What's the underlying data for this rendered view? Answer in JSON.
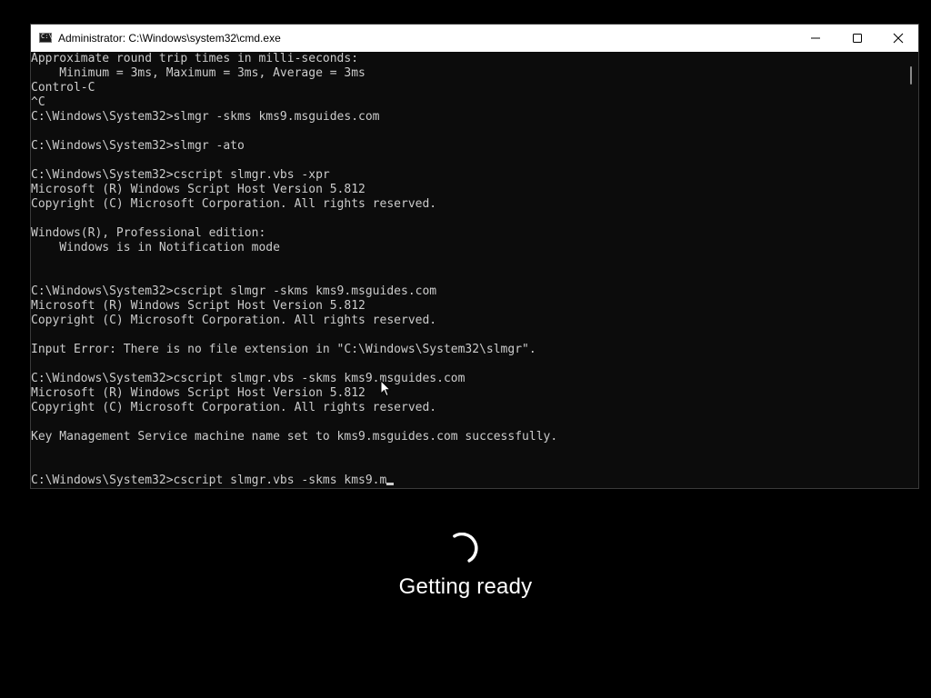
{
  "window": {
    "title": "Administrator: C:\\Windows\\system32\\cmd.exe",
    "icon": "cmd-app-icon",
    "controls": {
      "minimize_icon": "minimize-icon",
      "maximize_icon": "maximize-icon",
      "close_icon": "close-icon"
    }
  },
  "terminal": {
    "background": "#0c0c0c",
    "foreground": "#cccccc",
    "lines": [
      "Approximate round trip times in milli-seconds:",
      "    Minimum = 3ms, Maximum = 3ms, Average = 3ms",
      "Control-C",
      "^C",
      "C:\\Windows\\System32>slmgr -skms kms9.msguides.com",
      "",
      "C:\\Windows\\System32>slmgr -ato",
      "",
      "C:\\Windows\\System32>cscript slmgr.vbs -xpr",
      "Microsoft (R) Windows Script Host Version 5.812",
      "Copyright (C) Microsoft Corporation. All rights reserved.",
      "",
      "Windows(R), Professional edition:",
      "    Windows is in Notification mode",
      "",
      "",
      "C:\\Windows\\System32>cscript slmgr -skms kms9.msguides.com",
      "Microsoft (R) Windows Script Host Version 5.812",
      "Copyright (C) Microsoft Corporation. All rights reserved.",
      "",
      "Input Error: There is no file extension in \"C:\\Windows\\System32\\slmgr\".",
      "",
      "C:\\Windows\\System32>cscript slmgr.vbs -skms kms9.msguides.com",
      "Microsoft (R) Windows Script Host Version 5.812",
      "Copyright (C) Microsoft Corporation. All rights reserved.",
      "",
      "Key Management Service machine name set to kms9.msguides.com successfully.",
      "",
      ""
    ],
    "current_input": "C:\\Windows\\System32>cscript slmgr.vbs -skms kms9.m"
  },
  "overlay": {
    "spinner_icon": "loading-spinner-icon",
    "status_text": "Getting ready"
  }
}
